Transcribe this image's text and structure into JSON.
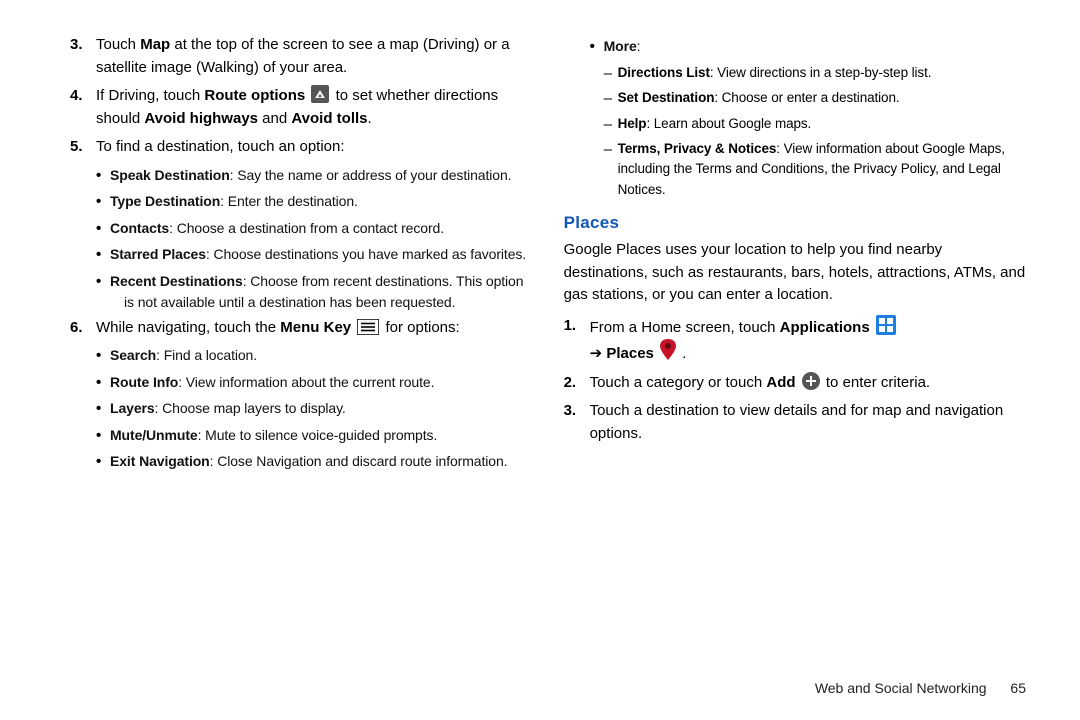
{
  "left": {
    "item3": {
      "num": "3.",
      "pre": "Touch ",
      "bold1": "Map",
      "post": " at the top of the screen to see a map (Driving) or a satellite image (Walking) of your area."
    },
    "item4": {
      "num": "4.",
      "pre": "If Driving, touch ",
      "bold1": "Route options",
      "mid": "  to set whether directions should ",
      "bold2": "Avoid highways",
      "and": " and ",
      "bold3": "Avoid tolls",
      "end": "."
    },
    "item5": {
      "num": "5.",
      "txt": "To find a destination, touch an option:",
      "bullets": [
        {
          "b": "Speak Destination",
          "t": ": Say the name or address of your destination."
        },
        {
          "b": "Type Destination",
          "t": ": Enter the destination."
        },
        {
          "b": "Contacts",
          "t": ": Choose a destination from a contact record."
        },
        {
          "b": "Starred Places",
          "t": ": Choose destinations you have marked as favorites."
        },
        {
          "b": "Recent Destinations",
          "t": ": Choose from recent destinations. This option",
          "cont": "is not available until a destination has been requested."
        }
      ]
    },
    "item6": {
      "num": "6.",
      "pre": "While navigating, touch the ",
      "bold1": "Menu Key",
      "post": "  for options:",
      "bullets": [
        {
          "b": "Search",
          "t": ": Find a location."
        },
        {
          "b": "Route Info",
          "t": ": View information about the current route."
        },
        {
          "b": "Layers",
          "t": ": Choose map layers to display."
        },
        {
          "b": "Mute/Unmute",
          "t": ": Mute to silence voice-guided prompts."
        },
        {
          "b": "Exit Navigation",
          "t": ": Close Navigation and discard route information."
        }
      ]
    }
  },
  "right": {
    "moreLabel": "More",
    "moreItems": [
      {
        "b": "Directions List",
        "t": ": View directions in a step-by-step list."
      },
      {
        "b": "Set Destination",
        "t": ": Choose or enter a destination."
      },
      {
        "b": "Help",
        "t": ": Learn about Google maps."
      },
      {
        "b": "Terms, Privacy & Notices",
        "t": ": View information about Google Maps, including the Terms and Conditions, the Privacy Policy, and Legal Notices."
      }
    ],
    "heading": "Places",
    "intro": "Google Places uses your location to help you find nearby destinations, such as restaurants, bars, hotels, attractions, ATMs, and gas stations, or you can enter a location.",
    "p1": {
      "num": "1.",
      "pre": "From a Home screen, touch ",
      "bold1": "Applications",
      "arrow": "➔ ",
      "bold2": "Places",
      "end": " ."
    },
    "p2": {
      "num": "2.",
      "pre": "Touch a category or touch ",
      "bold1": "Add",
      "post": "  to enter criteria."
    },
    "p3": {
      "num": "3.",
      "txt": "Touch a destination to view details and for map and navigation options."
    }
  },
  "footer": {
    "section": "Web and Social Networking",
    "page": "65"
  },
  "icons": {
    "routeOptions": "route-options-icon",
    "menuKey": "menu-key-icon",
    "applications": "applications-icon",
    "places": "places-pin-icon",
    "add": "add-circle-icon"
  }
}
